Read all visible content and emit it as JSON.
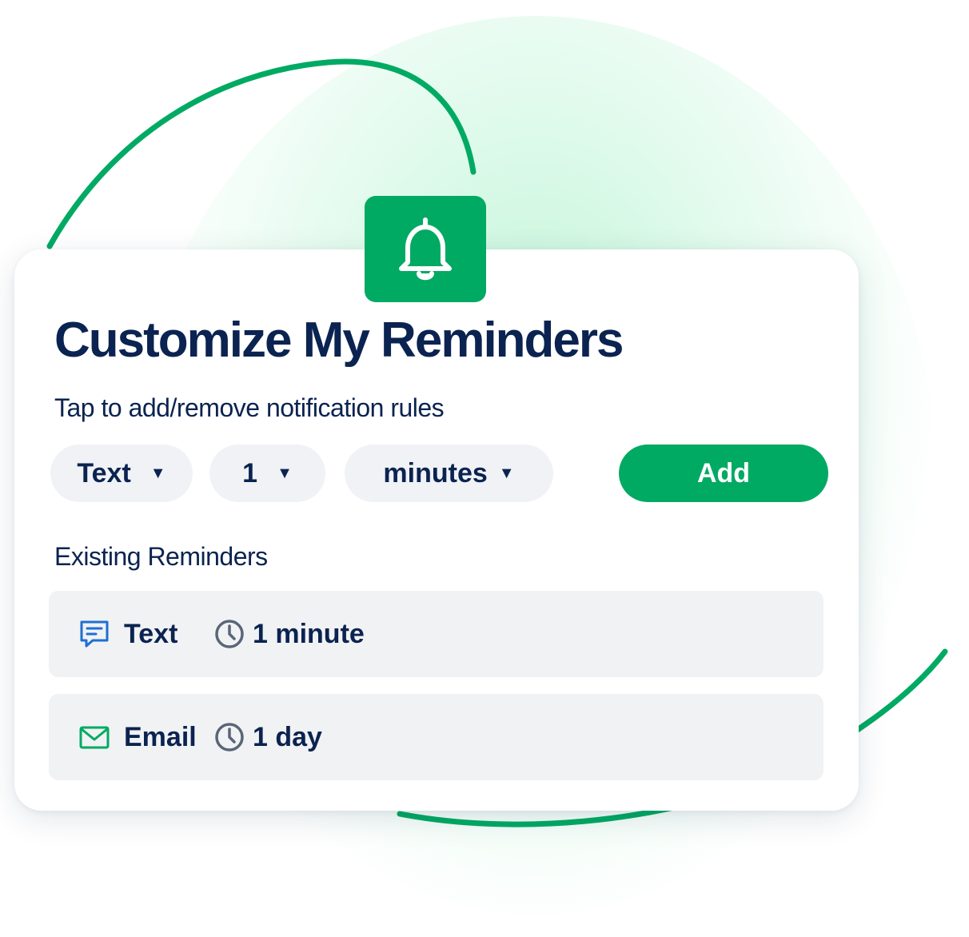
{
  "header": {
    "title": "Customize My Reminders",
    "subtitle": "Tap to add/remove notification rules",
    "badge_icon": "bell-icon"
  },
  "controls": {
    "channel": {
      "selected": "Text",
      "caret": "▼"
    },
    "amount": {
      "selected": "1",
      "caret": "▼"
    },
    "unit": {
      "selected": "minutes",
      "caret": "▼"
    },
    "add_label": "Add"
  },
  "existing": {
    "label": "Existing Reminders",
    "items": [
      {
        "icon": "chat-icon",
        "channel": "Text",
        "time_icon": "clock-icon",
        "duration": "1 minute"
      },
      {
        "icon": "envelope-icon",
        "channel": "Email",
        "time_icon": "clock-icon",
        "duration": "1 day"
      }
    ]
  },
  "colors": {
    "brand_green": "#00aa63",
    "navy_text": "#0b2350",
    "chat_icon_blue": "#1f6fd1",
    "clock_gray": "#5a6578",
    "row_background": "#f1f2f4"
  }
}
